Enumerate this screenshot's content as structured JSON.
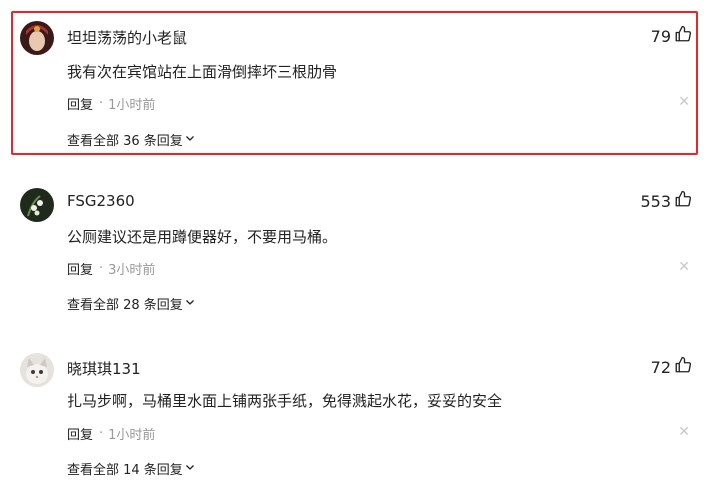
{
  "comments": [
    {
      "username": "坦坦荡荡的小老鼠",
      "likes": "79",
      "text": "我有次在宾馆站在上面滑倒摔坏三根肋骨",
      "reply_label": "回复",
      "separator": "·",
      "time": "1小时前",
      "view_all": "查看全部 36 条回复",
      "highlighted": true,
      "avatar_color": "#7a2f2a"
    },
    {
      "username": "FSG2360",
      "likes": "553",
      "text": "公厕建议还是用蹲便器好，不要用马桶。",
      "reply_label": "回复",
      "separator": "·",
      "time": "3小时前",
      "view_all": "查看全部 28 条回复",
      "highlighted": false,
      "avatar_color": "#2f3a2c"
    },
    {
      "username": "晓琪琪131",
      "likes": "72",
      "text": "扎马步啊，马桶里水面上铺两张手纸，免得溅起水花，妥妥的安全",
      "reply_label": "回复",
      "separator": "·",
      "time": "1小时前",
      "view_all": "查看全部 14 条回复",
      "highlighted": false,
      "avatar_color": "#d9d4cc"
    }
  ],
  "icons": {
    "like": "thumbs-up-icon",
    "close": "close-icon",
    "expand": "chevron-down-icon"
  },
  "colors": {
    "highlight_border": "#e8252a",
    "muted_text": "#999999"
  }
}
